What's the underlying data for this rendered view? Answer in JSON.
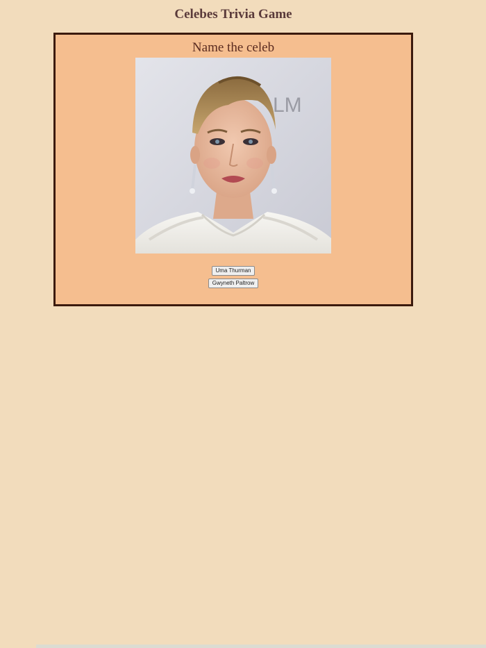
{
  "header": {
    "title": "Celebes Trivia Game"
  },
  "game": {
    "prompt": "Name the celeb",
    "photo": {
      "subject": "celebrity-portrait",
      "backdrop_text": "LM"
    },
    "options": [
      {
        "label": "Uma Thurman"
      },
      {
        "label": "Gwyneth Paltrow"
      }
    ]
  },
  "colors": {
    "page_background": "#f2dcbc",
    "card_background": "#f5be8f",
    "card_border": "#3b1a0d",
    "title_text": "#5a3a3a"
  }
}
